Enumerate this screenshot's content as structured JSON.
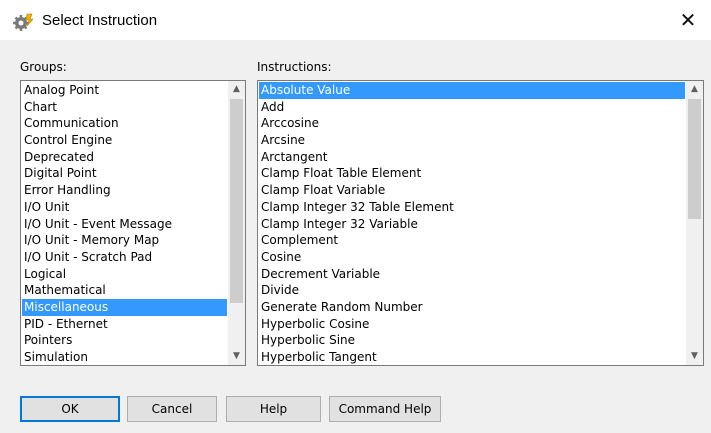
{
  "window": {
    "title": "Select Instruction",
    "close_glyph": "✕",
    "app_icon": "gear-icon"
  },
  "groups": {
    "label": "Groups:",
    "selected_index": 13,
    "items": [
      "Analog Point",
      "Chart",
      "Communication",
      "Control Engine",
      "Deprecated",
      "Digital Point",
      "Error Handling",
      "I/O Unit",
      "I/O Unit - Event Message",
      "I/O Unit - Memory Map",
      "I/O Unit - Scratch Pad",
      "Logical",
      "Mathematical",
      "Miscellaneous",
      "PID - Ethernet",
      "Pointers",
      "Simulation"
    ]
  },
  "instructions": {
    "label": "Instructions:",
    "selected_index": 0,
    "items": [
      "Absolute Value",
      "Add",
      "Arccosine",
      "Arcsine",
      "Arctangent",
      "Clamp Float Table Element",
      "Clamp Float Variable",
      "Clamp Integer 32 Table Element",
      "Clamp Integer 32 Variable",
      "Complement",
      "Cosine",
      "Decrement Variable",
      "Divide",
      "Generate Random Number",
      "Hyperbolic Cosine",
      "Hyperbolic Sine",
      "Hyperbolic Tangent"
    ]
  },
  "buttons": {
    "ok": "OK",
    "cancel": "Cancel",
    "help": "Help",
    "command_help": "Command Help"
  },
  "scroll_glyphs": {
    "up": "▲",
    "down": "▼"
  },
  "colors": {
    "selection": "#3399ff",
    "default_button_border": "#0078d7"
  }
}
